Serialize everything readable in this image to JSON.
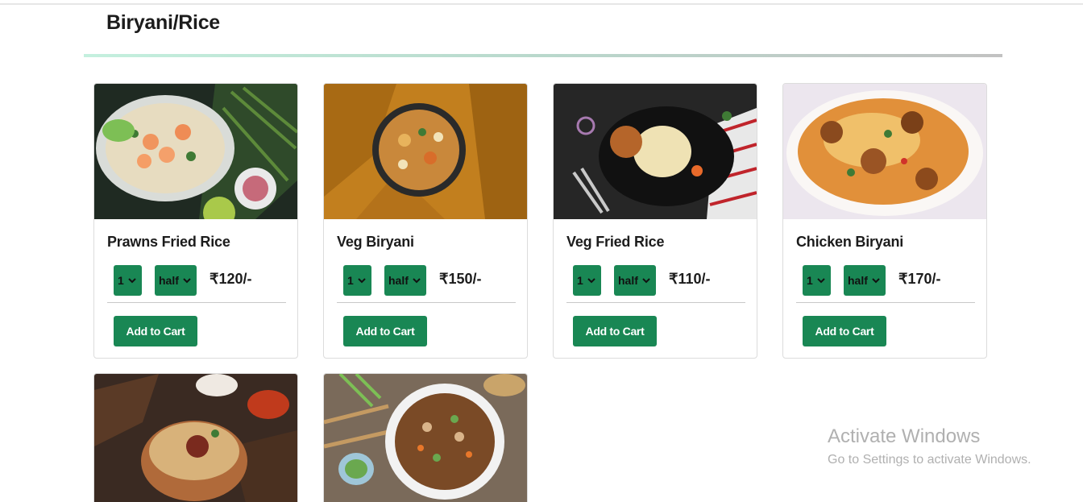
{
  "section": {
    "title": "Biryani/Rice"
  },
  "colors": {
    "accent": "#198754",
    "divider_start": "#c4f0de",
    "divider_end": "#c2c2c2"
  },
  "products": [
    {
      "name": "Prawns Fried Rice",
      "qty": "1",
      "size": "half",
      "price": "₹120/-",
      "button": "Add to Cart",
      "image": "prawns-fried-rice-photo"
    },
    {
      "name": "Veg Biryani",
      "qty": "1",
      "size": "half",
      "price": "₹150/-",
      "button": "Add to Cart",
      "image": "veg-biryani-photo"
    },
    {
      "name": "Veg Fried Rice",
      "qty": "1",
      "size": "half",
      "price": "₹110/-",
      "button": "Add to Cart",
      "image": "veg-fried-rice-photo"
    },
    {
      "name": "Chicken Biryani",
      "qty": "1",
      "size": "half",
      "price": "₹170/-",
      "button": "Add to Cart",
      "image": "chicken-biryani-photo"
    },
    {
      "image": "mutton-biryani-photo"
    },
    {
      "image": "egg-fried-rice-photo"
    }
  ],
  "watermark": {
    "title": "Activate Windows",
    "subtitle": "Go to Settings to activate Windows."
  }
}
